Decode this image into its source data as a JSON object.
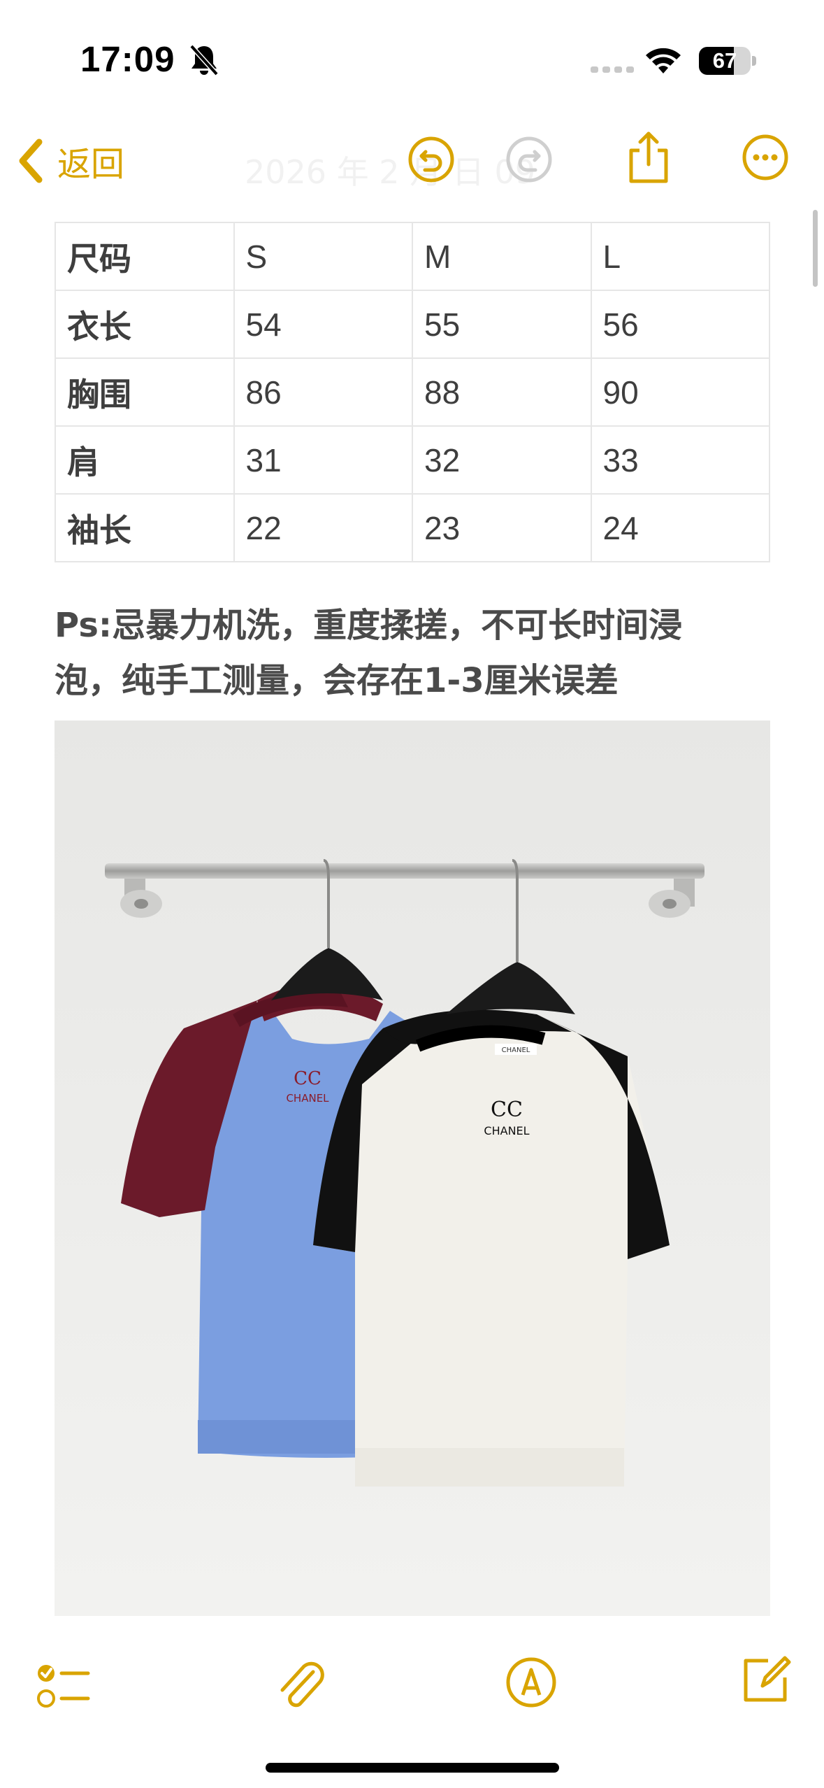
{
  "status_bar": {
    "time": "17:09",
    "battery_level": "67",
    "battery_fraction": 0.67,
    "icons": [
      "bell-slash-icon",
      "signal-icon",
      "wifi-icon",
      "battery-icon"
    ]
  },
  "nav": {
    "back_label": "返回",
    "title": "2026 年 2 月 日 09",
    "accent_color": "#d9a400",
    "icons": [
      "undo-icon",
      "redo-icon",
      "share-icon",
      "more-icon"
    ]
  },
  "size_table": {
    "rows": [
      {
        "label": "尺码",
        "values": [
          "S",
          "M",
          "L"
        ]
      },
      {
        "label": "衣长",
        "values": [
          "54",
          "55",
          "56"
        ]
      },
      {
        "label": "胸围",
        "values": [
          "86",
          "88",
          "90"
        ]
      },
      {
        "label": "肩",
        "values": [
          "31",
          "32",
          "33"
        ]
      },
      {
        "label": "袖长",
        "values": [
          "22",
          "23",
          "24"
        ]
      }
    ]
  },
  "note": {
    "line1": "Ps:忌暴力机洗，重度揉搓，不可长时间浸",
    "line2": "泡，纯手工测量，会存在1-3厘米误差"
  },
  "photo": {
    "left_logo": "CHANEL",
    "right_logo": "CHANEL",
    "tag_text": "CHANEL"
  },
  "toolbar": {
    "icons": [
      "checklist-icon",
      "attachment-icon",
      "markup-icon",
      "compose-icon"
    ]
  }
}
